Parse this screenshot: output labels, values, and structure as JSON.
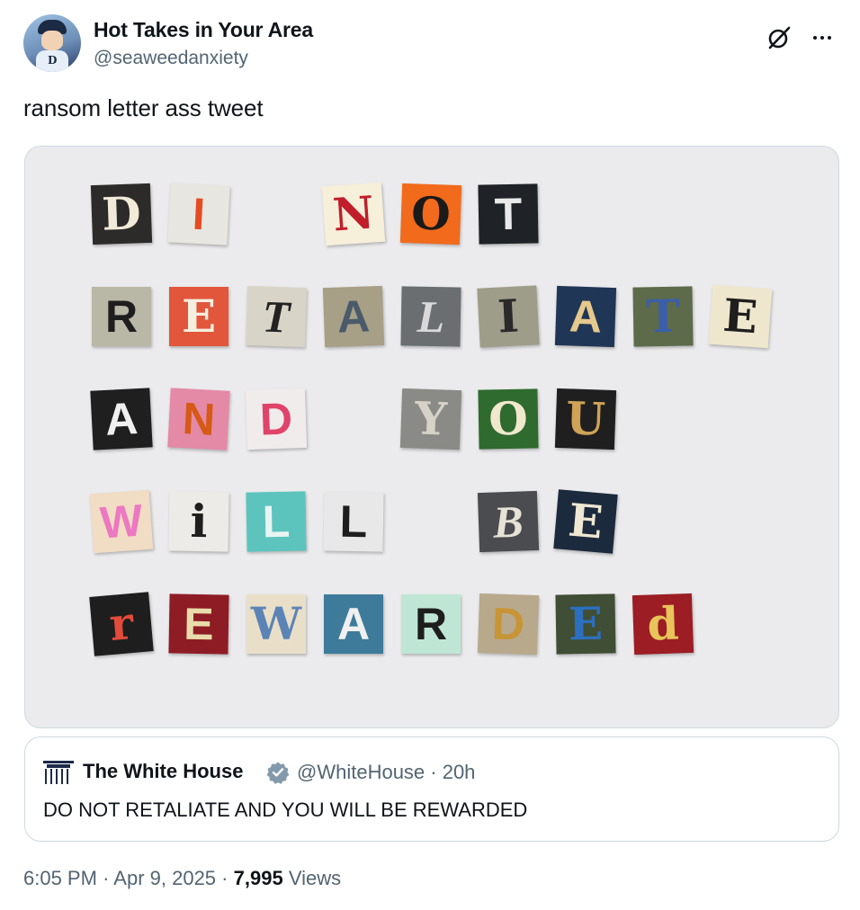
{
  "author": {
    "display_name": "Hot Takes in Your Area",
    "handle": "@seaweedanxiety",
    "avatar_icon": "anime-avatar-icon"
  },
  "actions": {
    "grok_icon": "grok-icon",
    "more_icon": "more-options-icon"
  },
  "tweet": {
    "text": "ransom letter ass tweet"
  },
  "media": {
    "background": "#ebebed",
    "lines": [
      {
        "words": [
          {
            "letters": [
              {
                "ch": "D",
                "bg": "#2d2b29",
                "fg": "#f1ead8",
                "style": "s1",
                "rot": -2
              },
              {
                "ch": "I",
                "bg": "#e8e6e0",
                "fg": "#e64b23",
                "style": "s2",
                "rot": 3
              }
            ]
          },
          {
            "letters": [
              {
                "ch": "N",
                "bg": "#f6efd9",
                "fg": "#c11d2a",
                "style": "s1",
                "rot": -4
              },
              {
                "ch": "O",
                "bg": "#f26a1b",
                "fg": "#1a1a1a",
                "style": "s1",
                "rot": 2
              },
              {
                "ch": "T",
                "bg": "#1f2226",
                "fg": "#e9e9e9",
                "style": "s2",
                "rot": -1
              }
            ]
          }
        ]
      },
      {
        "words": [
          {
            "letters": [
              {
                "ch": "R",
                "bg": "#b9b7a6",
                "fg": "#1e1e1e",
                "style": "s2",
                "rot": 0
              },
              {
                "ch": "E",
                "bg": "#e2563b",
                "fg": "#f4efdf",
                "style": "s1",
                "rot": 0
              },
              {
                "ch": "T",
                "bg": "#d8d4c8",
                "fg": "#222222",
                "style": "s3",
                "rot": 2
              },
              {
                "ch": "A",
                "bg": "#a79f86",
                "fg": "#4a5a6a",
                "style": "s2",
                "rot": -2
              },
              {
                "ch": "L",
                "bg": "#6b6e71",
                "fg": "#d9d9d9",
                "style": "s3",
                "rot": 1
              },
              {
                "ch": "I",
                "bg": "#9e9d8a",
                "fg": "#2a2a2a",
                "style": "s1",
                "rot": -3
              },
              {
                "ch": "A",
                "bg": "#1f3656",
                "fg": "#e6c98c",
                "style": "s2",
                "rot": 2
              },
              {
                "ch": "T",
                "bg": "#5e6b4a",
                "fg": "#3b5fa8",
                "style": "s1",
                "rot": -1
              },
              {
                "ch": "E",
                "bg": "#efe7cd",
                "fg": "#1e1e1e",
                "style": "s1",
                "rot": 4
              }
            ]
          }
        ]
      },
      {
        "words": [
          {
            "letters": [
              {
                "ch": "A",
                "bg": "#1f1f1f",
                "fg": "#f0f0f0",
                "style": "s2",
                "rot": -3
              },
              {
                "ch": "N",
                "bg": "#e489a6",
                "fg": "#d55a16",
                "style": "s2",
                "rot": 3
              },
              {
                "ch": "D",
                "bg": "#f0ecec",
                "fg": "#e0436a",
                "style": "s2",
                "rot": -2
              }
            ]
          },
          {
            "letters": [
              {
                "ch": "Y",
                "bg": "#8a8a86",
                "fg": "#d6d2c8",
                "style": "s1",
                "rot": 2
              },
              {
                "ch": "O",
                "bg": "#2f6a2f",
                "fg": "#f0e8cc",
                "style": "s1",
                "rot": -1
              },
              {
                "ch": "U",
                "bg": "#1f1f1f",
                "fg": "#cfa256",
                "style": "s1",
                "rot": 2
              }
            ]
          }
        ]
      },
      {
        "words": [
          {
            "letters": [
              {
                "ch": "W",
                "bg": "#f1dcc4",
                "fg": "#ec78c2",
                "style": "s2",
                "rot": -4
              },
              {
                "ch": "i",
                "bg": "#ecebe7",
                "fg": "#1e1e1e",
                "style": "s1",
                "rot": 1
              },
              {
                "ch": "L",
                "bg": "#5cc4bd",
                "fg": "#e8f4f2",
                "style": "s2",
                "rot": -1
              },
              {
                "ch": "L",
                "bg": "#e8e8e8",
                "fg": "#1e1e1e",
                "style": "s2",
                "rot": 1
              }
            ]
          },
          {
            "letters": [
              {
                "ch": "B",
                "bg": "#4a4c4f",
                "fg": "#e6e2d6",
                "style": "s3",
                "rot": -2
              },
              {
                "ch": "E",
                "bg": "#1c2a3d",
                "fg": "#efe7d3",
                "style": "s1",
                "rot": 5
              }
            ]
          }
        ]
      },
      {
        "words": [
          {
            "letters": [
              {
                "ch": "r",
                "bg": "#1e1e1e",
                "fg": "#e24a3a",
                "style": "s1",
                "rot": -5
              },
              {
                "ch": "E",
                "bg": "#8e1c25",
                "fg": "#e8dcaa",
                "style": "s2",
                "rot": 1
              },
              {
                "ch": "W",
                "bg": "#e9dfc9",
                "fg": "#5c83b5",
                "style": "s1",
                "rot": 0
              },
              {
                "ch": "A",
                "bg": "#3e7a9a",
                "fg": "#f0f0f0",
                "style": "s2",
                "rot": 0
              },
              {
                "ch": "R",
                "bg": "#bfe6d4",
                "fg": "#1e1e1e",
                "style": "s2",
                "rot": 0
              },
              {
                "ch": "D",
                "bg": "#b8a98c",
                "fg": "#c79535",
                "style": "s2",
                "rot": 2
              },
              {
                "ch": "E",
                "bg": "#3f4e34",
                "fg": "#2c6fbf",
                "style": "s1",
                "rot": -1
              },
              {
                "ch": "d",
                "bg": "#9c1d24",
                "fg": "#e8c45a",
                "style": "s1",
                "rot": -2
              }
            ]
          }
        ]
      }
    ]
  },
  "quote": {
    "avatar_icon": "white-house-icon",
    "name": "The White House",
    "verified_icon": "verified-badge-icon",
    "meta": "@WhiteHouse · 20h",
    "text": "DO NOT RETALIATE AND YOU WILL BE REWARDED"
  },
  "footer": {
    "time": "6:05 PM",
    "date": "Apr 9, 2025",
    "views_count": "7,995",
    "views_label": "Views"
  }
}
